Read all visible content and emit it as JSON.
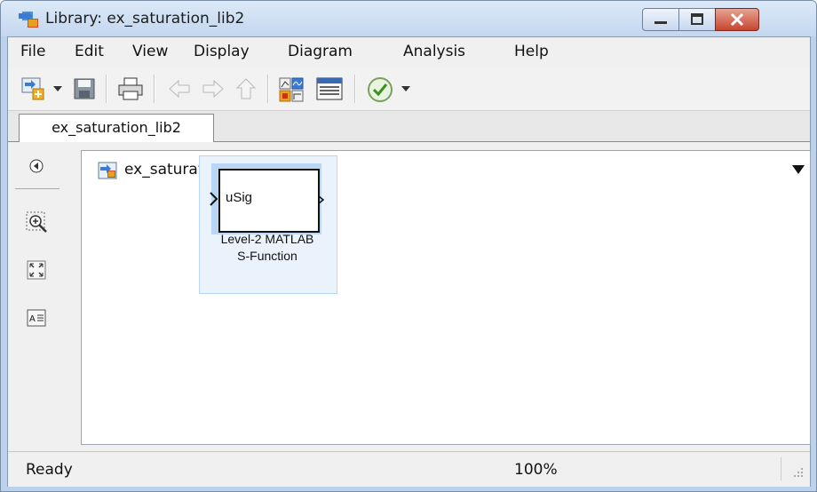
{
  "window": {
    "title": "Library: ex_saturation_lib2"
  },
  "menu": {
    "items": [
      "File",
      "Edit",
      "View",
      "Display",
      "Diagram",
      "Analysis",
      "Help"
    ]
  },
  "toolbar": {
    "icons": [
      "new-model-icon",
      "dropdown-arrow-icon",
      "save-icon",
      "print-icon",
      "back-arrow-icon",
      "forward-arrow-icon",
      "up-arrow-icon",
      "library-browser-icon",
      "model-explorer-icon",
      "check-icon",
      "dropdown-arrow-icon"
    ]
  },
  "tabs": [
    {
      "label": "ex_saturation_lib2"
    }
  ],
  "address": {
    "path": "ex_saturation_lib2"
  },
  "side_tools": [
    "hide-browser-icon",
    "zoom-in-icon",
    "fit-view-icon",
    "text-annotation-icon"
  ],
  "block": {
    "port_label": "uSig",
    "caption_line1": "Level-2 MATLAB",
    "caption_line2": "S-Function"
  },
  "status": {
    "text": "Ready",
    "zoom": "100%"
  },
  "colors": {
    "title_bar": "#c3d7ef",
    "close_button": "#c74530",
    "block_selection": "#b9d6f5",
    "port_orange": "#e8a020"
  }
}
